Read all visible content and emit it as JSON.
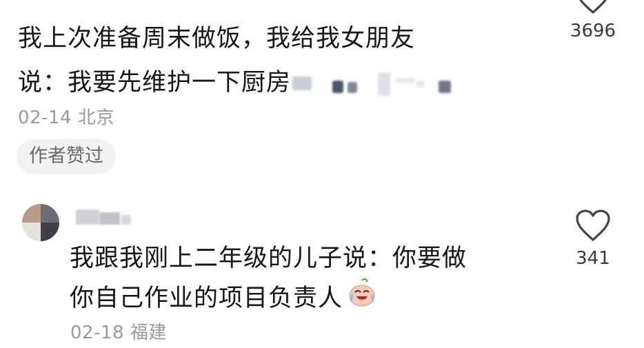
{
  "comments": [
    {
      "text_line1": "我上次准备周末做饭，我给我女朋友",
      "text_line2": "说：我要先维护一下厨房",
      "date": "02-14",
      "location": "北京",
      "badge": "作者赞过",
      "likes": "3696",
      "like_icon": "heart-outline-icon"
    },
    {
      "text_line1": "我跟我刚上二年级的儿子说：你要做",
      "text_line2": "你自己作业的项目负责人",
      "emoji": "laughing-crying-face",
      "date": "02-18",
      "location": "福建",
      "likes": "341",
      "like_icon": "heart-outline-icon"
    }
  ],
  "colors": {
    "text": "#161616",
    "meta": "#9a9a9a",
    "badge_bg": "#f2f2f2",
    "badge_text": "#6a6a6a",
    "heart_stroke": "#444444"
  }
}
